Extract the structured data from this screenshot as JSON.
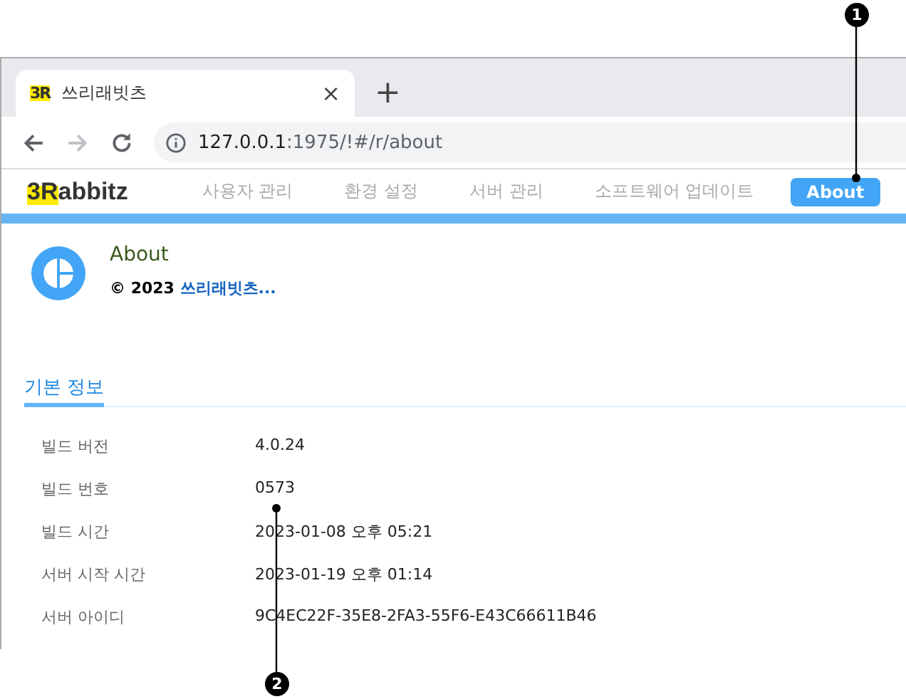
{
  "browser": {
    "tab": {
      "favicon": "3R",
      "title": "쓰리래빗츠",
      "close": "×"
    },
    "new_tab": "+",
    "address": {
      "host": "127.0.0.1",
      "rest": ":1975/!#/r/about"
    }
  },
  "app": {
    "logo": {
      "first": "3R",
      "rest": "abbitz"
    },
    "nav": [
      {
        "label": "사용자 관리",
        "selected": false
      },
      {
        "label": "환경 설정",
        "selected": false
      },
      {
        "label": "서버 관리",
        "selected": false
      },
      {
        "label": "소프트웨어 업데이트",
        "selected": false
      },
      {
        "label": "About",
        "selected": true
      }
    ],
    "header": {
      "title": "About",
      "copyright": "© 2023",
      "company": "쓰리래빗츠..."
    },
    "section_tab": "기본 정보",
    "rows": [
      {
        "label": "빌드 버전",
        "value": "4.0.24"
      },
      {
        "label": "빌드 번호",
        "value": "0573"
      },
      {
        "label": "빌드 시간",
        "value": "2023-01-08 오후 05:21"
      },
      {
        "label": "서버 시작 시간",
        "value": "2023-01-19 오후 01:14"
      },
      {
        "label": "서버 아이디",
        "value": "9C4EC22F-35E8-2FA3-55F6-E43C66611B46"
      }
    ]
  },
  "callouts": [
    "1",
    "2"
  ]
}
